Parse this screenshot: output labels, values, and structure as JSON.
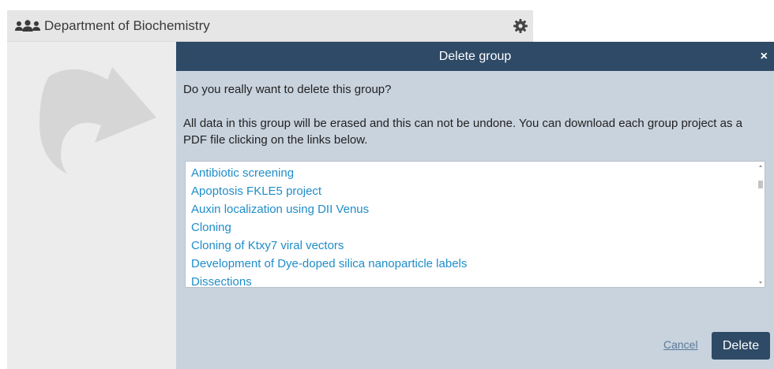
{
  "group": {
    "title": "Department of Biochemistry",
    "icon": "group-users-icon",
    "settings_icon": "gear-icon"
  },
  "modal": {
    "title": "Delete group",
    "close_label": "×",
    "question": "Do you really want to delete this group?",
    "warning": "All data in this group will be erased and this can not be undone. You can download each group project as a PDF file clicking on the links below.",
    "projects": [
      "Antibiotic screening",
      "Apoptosis FKLE5 project",
      "Auxin localization using DII Venus",
      "Cloning",
      "Cloning of Ktxy7 viral vectors",
      "Development of Dye-doped silica nanoparticle labels",
      "Dissections"
    ],
    "cancel_label": "Cancel",
    "delete_label": "Delete"
  },
  "colors": {
    "modal_header": "#2e4a66",
    "modal_body": "#c9d3de",
    "link": "#1f8dc9"
  }
}
